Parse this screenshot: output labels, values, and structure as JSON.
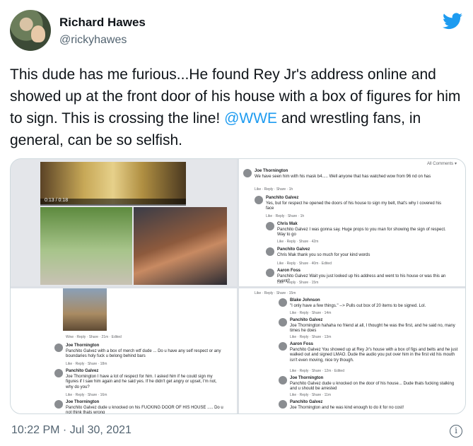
{
  "author": {
    "name": "Richard Hawes",
    "handle": "@rickyhawes"
  },
  "tweet": {
    "text_before": "This dude has me furious...He found Rey Jr's address online and showed up at the front door of his house with a box of figures for him to sign. This is crossing the line! ",
    "mention": "@WWE",
    "text_after": " and wrestling fans, in general, can be so selfish."
  },
  "media": {
    "video_time": "0:13 / 0:18",
    "all_comments": "All Comments ▾",
    "q2": [
      {
        "author": "Joe Thornington",
        "text": "We have seen him with his mask b4..... Well anyone that has watched wow from 96 nd on has",
        "meta": "Like · Reply · Share · 1h"
      },
      {
        "author": "Panchito Galvez",
        "text": "Yes, but for respect he opened the doors of his house to sign my belt, that's why I covered his face",
        "meta": "Like · Reply · Share · 1h"
      },
      {
        "author": "Chris Mak",
        "text": "Panchito Galvez I was gonna say. Huge props to you man for showing the sign of respect. Way to go",
        "meta": "Like · Reply · Share · 42m"
      },
      {
        "author": "Panchito Galvez",
        "text": "Chris Mak thank you so much for your kind words",
        "meta": "Like · Reply · Share · 40m · Edited"
      },
      {
        "author": "Aaron Foss",
        "text": "Panchito Galvez Wait you just looked up his address and went to his house or was this an event?",
        "meta": "Like · Reply · Share · 15m"
      }
    ],
    "q3": [
      {
        "author": "Joe Thornington",
        "text": "Panchito Galvez with a box of merch wtf dude ... Do u have any self respect or any boundaries holy fuck u belong behind bars",
        "meta": "Like · Reply · Share · 18m"
      },
      {
        "author": "Panchito Galvez",
        "text": "Joe Thornington I have a lot of respect for him. I asked him if he could sign my figures if I saw him again and he said yes. If he didn't get angry or upset, I'm not, why do you?",
        "meta": "Like · Reply · Share · 16m"
      },
      {
        "author": "Joe Thornington",
        "text": "Panchito Galvez dude u knocked on his FUCKING DOOR OF HIS HOUSE ..... Do u not think thats wrong",
        "meta": ""
      }
    ],
    "q3_top_meta": "Wow · Reply · Share · 21m · Edited",
    "q4": [
      {
        "author": "Blake Johnson",
        "text": "\"I only have a few things.\" --> Pulls out box of 20 items to be signed. Lol.",
        "meta": "Like · Reply · Share · 14m"
      },
      {
        "author": "Panchito Galvez",
        "text": "Joe Thornington hahaha no friend at all, I thought he was the first, and he said no, many times he does",
        "meta": "Like · Reply · Share · 13m"
      },
      {
        "author": "Aaron Foss",
        "text": "Panchito Galvez You showed up at Rey Jr's house with a box of figs and belts and he just walked out and signed LMAO. Dude the audio you put over him in the first vid his mouth isn't even moving, nice try though.",
        "meta": "Like · Reply · Share · 12m · Edited"
      },
      {
        "author": "Joe Thornington",
        "text": "Panchito Galvez dude u knocked on the door of his house... Dude thats fucking stalking and u should be arrested",
        "meta": "Like · Reply · Share · 11m"
      },
      {
        "author": "Panchito Galvez",
        "text": "Joe Thornington and he was kind enough to do it for no cost!",
        "meta": ""
      }
    ],
    "q4_top_meta": "Like · Reply · Share · 15m"
  },
  "timestamp": "10:22 PM · Jul 30, 2021",
  "colors": {
    "accent": "#1d9bf0",
    "secondary_text": "#536471"
  },
  "icons": {
    "bird": "twitter-bird-icon",
    "info": "info-icon"
  }
}
